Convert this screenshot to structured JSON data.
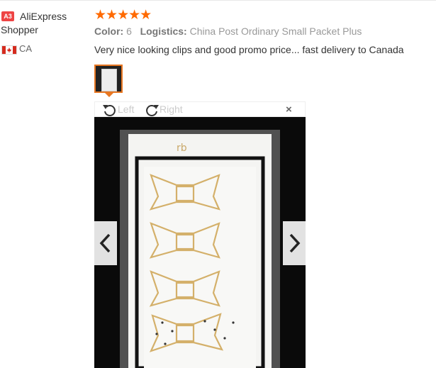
{
  "user": {
    "badge": "A3",
    "name_line1": "AliExpress",
    "name_line2": "Shopper",
    "country": "CA"
  },
  "review": {
    "rating": 5,
    "stars": "★★★★★",
    "color_label": "Color:",
    "color_value": "6",
    "logistics_label": "Logistics:",
    "logistics_value": "China Post Ordinary Small Packet Plus",
    "text": "Very nice looking clips and good promo price... fast delivery to Canada"
  },
  "viewer": {
    "rotate_left_label": "Left",
    "rotate_right_label": "Right",
    "close_label": "×",
    "prev_icon": "chevron-left-icon",
    "next_icon": "chevron-right-icon"
  },
  "colors": {
    "accent": "#e87722",
    "star": "#ff6a00",
    "badge": "#ee4444"
  }
}
